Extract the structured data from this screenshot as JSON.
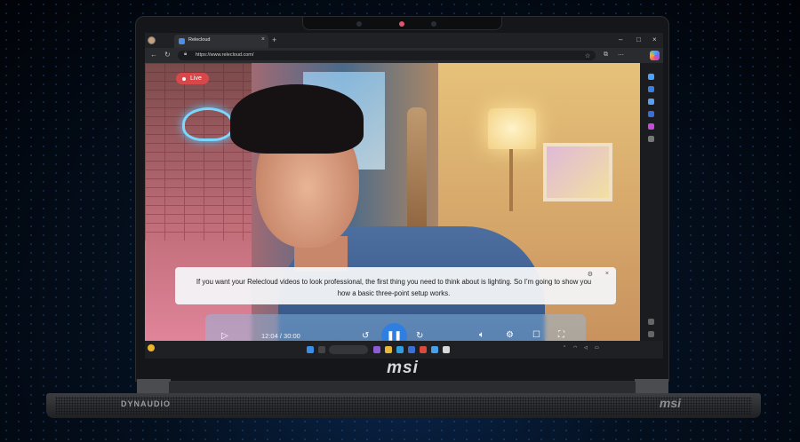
{
  "browser": {
    "tab_title": "Relecloud",
    "url": "https://www.relecloud.com/"
  },
  "video": {
    "live_label": "Live",
    "caption": "If you want your Relecloud videos to look professional, the first thing you need to think about is lighting. So I’m going to show you how a basic three-point setup works.",
    "current_time": "12:04",
    "duration": "30:00",
    "time_display": "12:04 / 30:00",
    "progress": 0.32
  },
  "laptop": {
    "logo": "msi",
    "audio_brand": "DYNAUDIO"
  },
  "colors": {
    "accent": "#2f7fe0",
    "live_badge": "#d8484a"
  },
  "icons": [
    "play-icon",
    "rewind-icon",
    "pause-icon",
    "forward-icon",
    "volume-icon",
    "settings-icon",
    "miniplayer-icon",
    "fullscreen-icon",
    "close-icon",
    "copilot-icon"
  ]
}
